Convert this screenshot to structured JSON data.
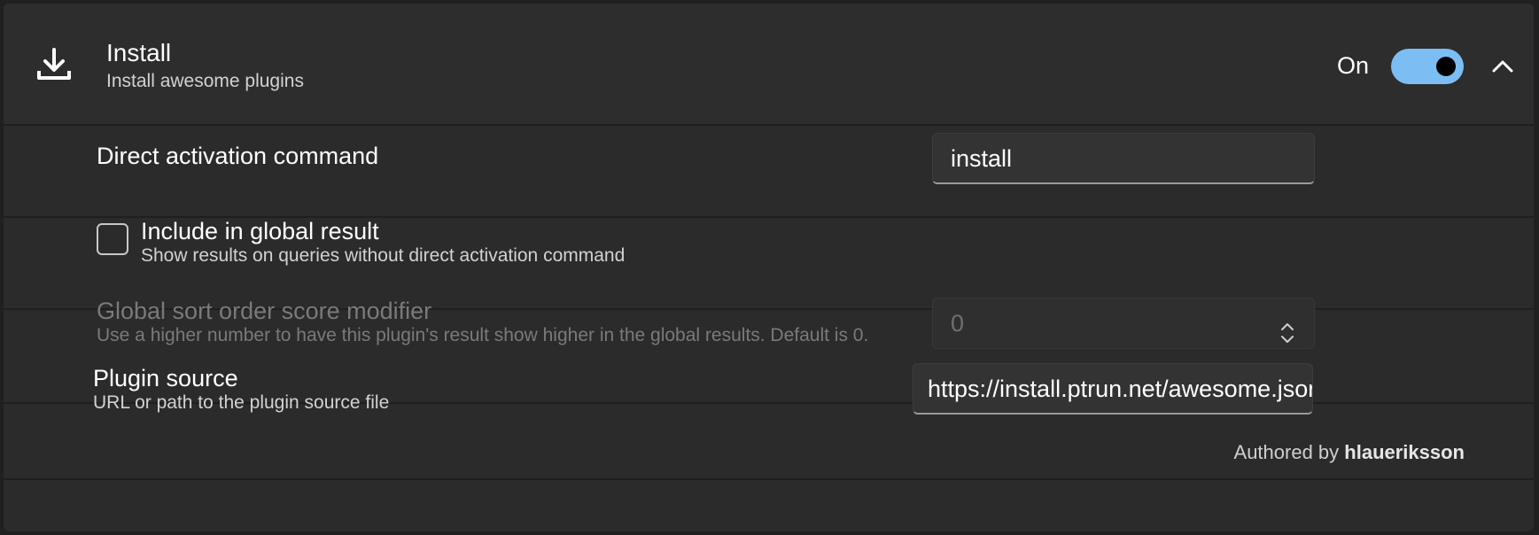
{
  "plugin": {
    "title": "Install",
    "subtitle": "Install awesome plugins",
    "enabled_label": "On",
    "enabled": true,
    "icon": "download-icon",
    "accent_color": "#7cbdf4"
  },
  "settings": {
    "activation": {
      "label": "Direct activation command",
      "value": "install"
    },
    "global_result": {
      "label": "Include in global result",
      "description": "Show results on queries without direct activation command",
      "checked": false
    },
    "sort_modifier": {
      "label": "Global sort order score modifier",
      "description": "Use a higher number to have this plugin's result show higher in the global results. Default is 0.",
      "value": "0",
      "disabled": true
    },
    "plugin_source": {
      "label": "Plugin source",
      "description": "URL or path to the plugin source file",
      "value": "https://install.ptrun.net/awesome.json"
    }
  },
  "footer": {
    "authored_prefix": "Authored by",
    "author": "hlaueriksson"
  }
}
